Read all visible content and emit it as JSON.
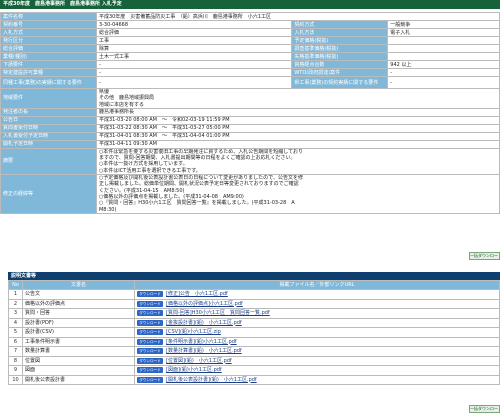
{
  "header": {
    "title": "平成30年度　鹿島港事務所　鹿島港事務所 入札予定"
  },
  "info_rows": [
    {
      "type": "quad",
      "l1": "案件名称",
      "v1": "平成30年度　災害備蓄品防災工事　（鉛）高浜川　鹿島港事務所　小六1工区"
    },
    {
      "type": "quad",
      "l1": "契約番号",
      "v1": "3-30-04668",
      "l2": "契約方式",
      "v2": "一般競争"
    },
    {
      "type": "quad",
      "l1": "入札方式",
      "v1": "総合評価",
      "l2": "入札方法",
      "v2": "電子入札"
    },
    {
      "type": "quad",
      "l1": "発行区分",
      "v1": "工事",
      "l2": "予定価格(税抜)",
      "v2": ""
    },
    {
      "type": "quad",
      "l1": "総合評価",
      "v1": "除算",
      "l2": "調査基準価格(税抜)",
      "v2": ""
    },
    {
      "type": "quad",
      "l1": "業種(種別)",
      "v1": "土木一式工事",
      "l2": "失格基準価格(税抜)",
      "v2": ""
    },
    {
      "type": "quad",
      "l1": "下請要件",
      "v1": "-",
      "l2": "資格経点合数",
      "v2": "942 以上"
    },
    {
      "type": "quad",
      "l1": "特定建設許可業種",
      "v1": "-",
      "l2": "WTO(政府調達)案件",
      "v2": "-"
    },
    {
      "type": "quad",
      "l1": "同種工事(業務)の実績に関する要件",
      "v1": "-",
      "l2": "県工事(業務)の契約実績に関する要件",
      "v2": "-"
    },
    {
      "type": "lines",
      "l1": "地域要件",
      "lines": [
        "県優",
        "その他　鹿島地域振興局",
        "地域に本店を有する"
      ]
    },
    {
      "type": "single",
      "l1": "発注者の長",
      "v1": "鹿島港事務所長"
    },
    {
      "type": "single",
      "l1": "公告日",
      "v1": "平成31-03-20 08:00 AM　～　令和02-03-19 11:59 PM"
    },
    {
      "type": "single",
      "l1": "質問書受付日時",
      "v1": "平成31-03-22 08:30 AM　～　平成31-03-27 05:00 PM"
    },
    {
      "type": "single",
      "l1": "入札書受付予定日時",
      "v1": "平成31-04-01 08:30 AM　～　平成31-04-04 01:00 PM"
    },
    {
      "type": "single",
      "l1": "開札予定日時",
      "v1": "平成31-04-11 09:30 AM"
    },
    {
      "type": "lines",
      "l1": "摘要",
      "lines": [
        "○本件は緊急を要する災害復旧工事の早期発注に資するため、入札公告期間を短縮しており",
        "ますので、質問-回答期間、入札書提出期間等の日程をよくご確認の上お応札ください。",
        "○本件は一抜け方式を採用しています。",
        "○本件はICT活用工事を選択できる工事です。"
      ]
    },
    {
      "type": "lines",
      "l1": "修正の経緯等",
      "lines": [
        "○予定価格及び開札後公表設計書公表日の日程について変更がありましたので、公告文を修",
        "正し掲載しました。総価単位期間、開札状況公表予定日等変更されておりますのでご確認",
        "ください。(平成31-04-15　AM8:50)",
        "○価格以外の評価点を掲載しました。(平成31-04-08　AM9:00)",
        "○『質問・回答』H30小六1工区　質問回答一覧』を掲載しました。(平成31-03-28　A",
        "M8:30)"
      ]
    }
  ],
  "download_all_label": "一括ダウンロード",
  "docs_section_title": "説明文書等",
  "docs_headers": {
    "no": "No",
    "name": "文書名",
    "file": "掲載ファイル名／外部リンクURL"
  },
  "dl_button_label": "ダウンロード",
  "docs": [
    {
      "no": "1",
      "name": "公告文",
      "file": "[修正]公告　小六1工区.pdf"
    },
    {
      "no": "2",
      "name": "価格以外の評価点",
      "file": "[価格以外の評価点]小六1工区.pdf"
    },
    {
      "no": "3",
      "name": "質問・回答",
      "file": "[質問-回答]H30小六1工区　質問回答一覧.pdf"
    },
    {
      "no": "4",
      "name": "設計書(PDF)",
      "file": "[金抜設計書](鉛)　小六1工区.pdf"
    },
    {
      "no": "5",
      "name": "設計書(CSV)",
      "file": "[CSV](鉛)小六1工区.zip"
    },
    {
      "no": "6",
      "name": "工事条件明示書",
      "file": "[条件明示書](鉛)小六1工区.pdf"
    },
    {
      "no": "7",
      "name": "数量計算書",
      "file": "[数量計算書](鉛)　小六1工区.pdf"
    },
    {
      "no": "8",
      "name": "位置図",
      "file": "[位置図](鉛)　小六1工区.pdf"
    },
    {
      "no": "9",
      "name": "図面",
      "file": "[図面](鉛)小六1工区.pdf"
    },
    {
      "no": "10",
      "name": "開札後公表設計書",
      "file": "[開札後公表設計書](鉛)　小六1工区.pdf"
    }
  ]
}
